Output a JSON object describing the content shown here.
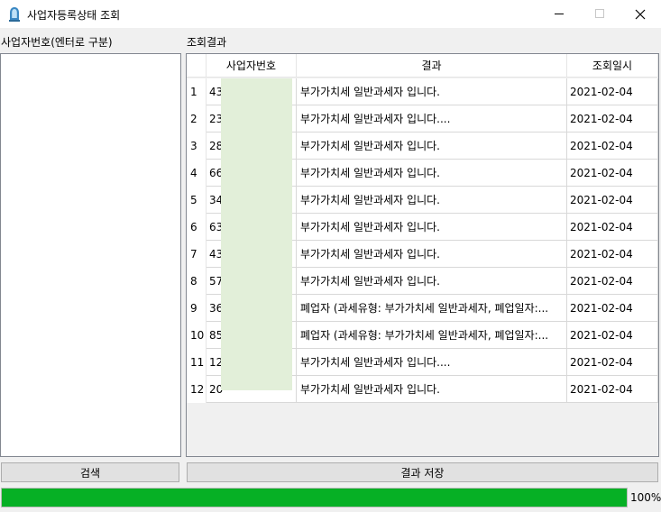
{
  "window": {
    "title": "사업자등록상태 조회"
  },
  "left": {
    "label": "사업자번호(엔터로 구분)",
    "input_value": ""
  },
  "right": {
    "label": "조회결과"
  },
  "table": {
    "headers": [
      "사업자번호",
      "결과",
      "조회일시"
    ],
    "rows": [
      {
        "num": "1",
        "biz": "43",
        "result": "부가가치세 일반과세자 입니다.",
        "date": "2021-02-04"
      },
      {
        "num": "2",
        "biz": "23",
        "result": "부가가치세 일반과세자 입니다....",
        "date": "2021-02-04"
      },
      {
        "num": "3",
        "biz": "28",
        "result": "부가가치세 일반과세자 입니다.",
        "date": "2021-02-04"
      },
      {
        "num": "4",
        "biz": "66",
        "result": "부가가치세 일반과세자 입니다.",
        "date": "2021-02-04"
      },
      {
        "num": "5",
        "biz": "34",
        "result": "부가가치세 일반과세자 입니다.",
        "date": "2021-02-04"
      },
      {
        "num": "6",
        "biz": "63",
        "result": "부가가치세 일반과세자 입니다.",
        "date": "2021-02-04"
      },
      {
        "num": "7",
        "biz": "43",
        "result": "부가가치세 일반과세자 입니다.",
        "date": "2021-02-04"
      },
      {
        "num": "8",
        "biz": "57",
        "result": "부가가치세 일반과세자 입니다.",
        "date": "2021-02-04"
      },
      {
        "num": "9",
        "biz": "36",
        "result": "폐업자 (과세유형: 부가가치세 일반과세자, 폐업일자:...",
        "date": "2021-02-04"
      },
      {
        "num": "10",
        "biz": "85",
        "result": "폐업자 (과세유형: 부가가치세 일반과세자, 폐업일자:...",
        "date": "2021-02-04"
      },
      {
        "num": "11",
        "biz": "12",
        "result": "부가가치세 일반과세자 입니다....",
        "date": "2021-02-04"
      },
      {
        "num": "12",
        "biz": "20",
        "result": "부가가치세 일반과세자 입니다.",
        "date": "2021-02-04"
      }
    ]
  },
  "buttons": {
    "search": "검색",
    "save": "결과 저장"
  },
  "progress": {
    "value": 1.0,
    "label": "100%"
  },
  "colors": {
    "progress_fill": "#06b025",
    "redaction": "#e2efd9"
  }
}
